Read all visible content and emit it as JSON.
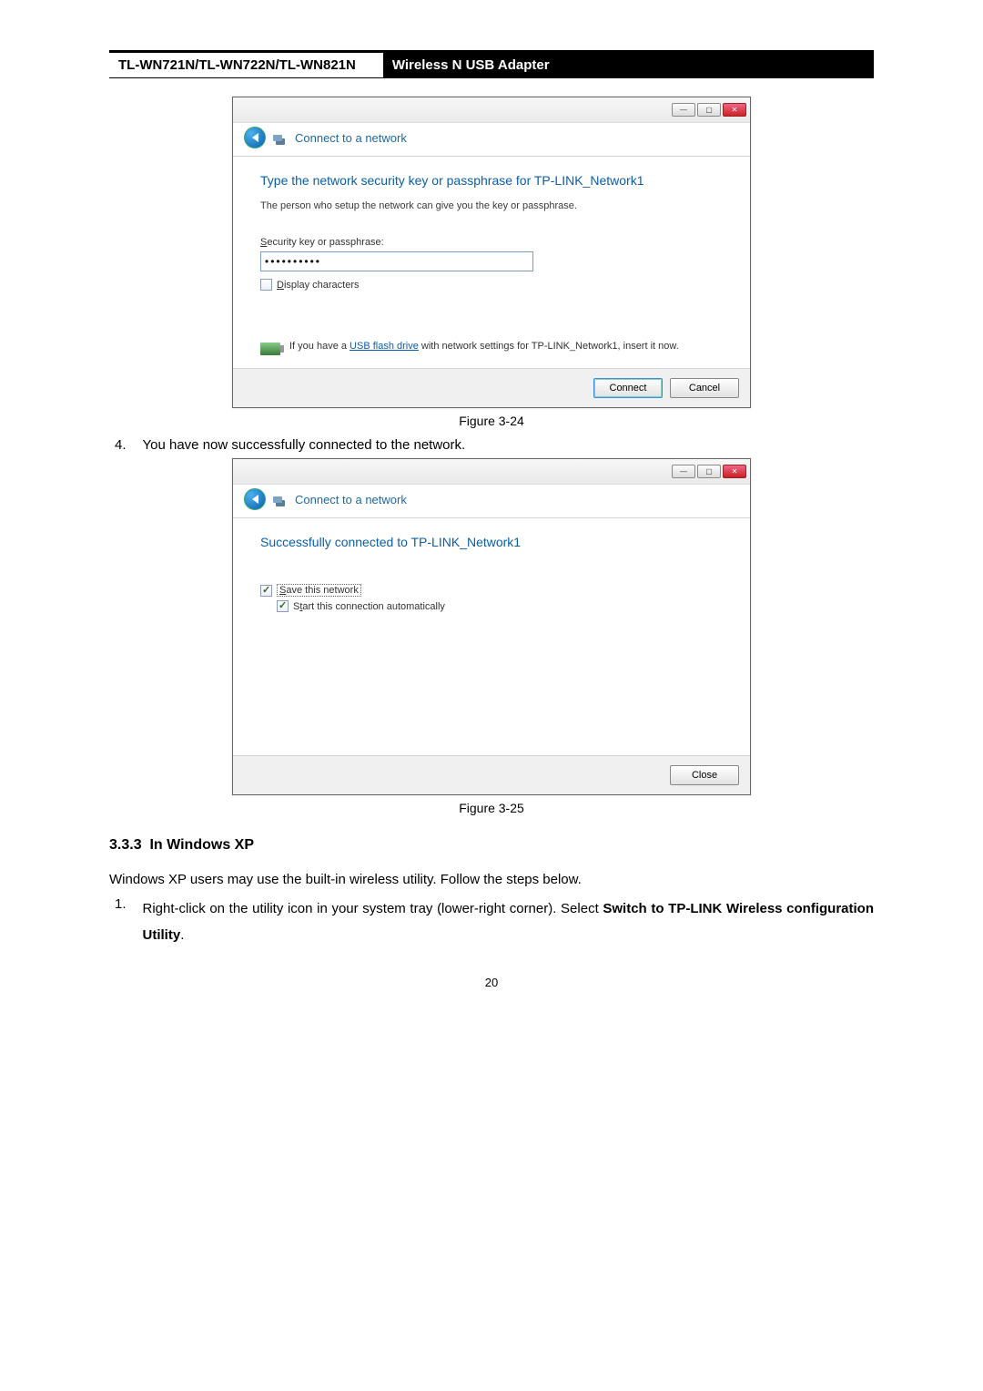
{
  "header": {
    "model": "TL-WN721N/TL-WN722N/TL-WN821N",
    "product": "Wireless N USB Adapter"
  },
  "dialog1": {
    "window_title": "Connect to a network",
    "heading": "Type the network security key or passphrase for TP-LINK_Network1",
    "subtext": "The person who setup the network can give you the key or passphrase.",
    "label_prefix": "S",
    "label_rest": "ecurity key or passphrase:",
    "value": "••••••••••",
    "display_prefix": "D",
    "display_rest": "isplay characters",
    "usb_prefix": "If you have a ",
    "usb_link": "USB flash drive",
    "usb_suffix": " with network settings for TP-LINK_Network1, insert it now.",
    "connect": "Connect",
    "cancel": "Cancel"
  },
  "caption1": "Figure 3-24",
  "step4_num": "4.",
  "step4_text": "You have now successfully connected to the network.",
  "dialog2": {
    "window_title": "Connect to a network",
    "heading": "Successfully connected to TP-LINK_Network1",
    "save_prefix": "S",
    "save_rest": "ave this network",
    "start_prefix": "S",
    "start_mid": "t",
    "start_rest": "art this connection automatically",
    "close": "Close"
  },
  "caption2": "Figure 3-25",
  "section": {
    "number": "3.3.3",
    "title": "In Windows XP"
  },
  "xp_intro": "Windows XP users may use the built-in wireless utility. Follow the steps below.",
  "xp_step1_num": "1.",
  "xp_step1_a": "Right-click on the utility icon in your system tray (lower-right corner). Select ",
  "xp_step1_b": "Switch to TP-LINK Wireless configuration Utility",
  "xp_step1_c": ".",
  "page_number": "20"
}
